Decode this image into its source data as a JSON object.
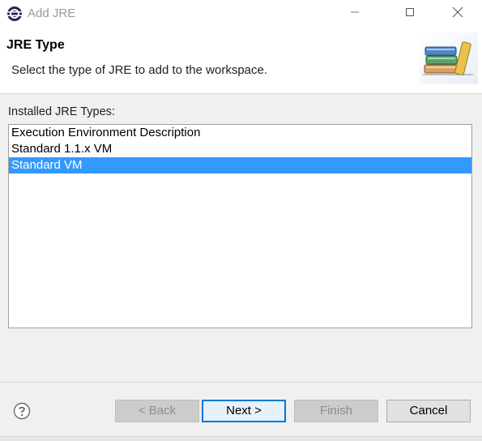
{
  "window": {
    "title": "Add JRE",
    "app_icon": "eclipse-icon",
    "controls": [
      "minimize-icon",
      "maximize-icon",
      "close-icon"
    ]
  },
  "header": {
    "title": "JRE Type",
    "description": "Select the type of JRE to add to the workspace.",
    "banner_icon": "books-icon"
  },
  "main": {
    "list_label": "Installed JRE Types:",
    "jre_types": [
      {
        "label": "Execution Environment Description",
        "selected": false
      },
      {
        "label": "Standard 1.1.x VM",
        "selected": false
      },
      {
        "label": "Standard VM",
        "selected": true
      }
    ]
  },
  "footer": {
    "help_icon": "help-icon",
    "back_label": "< Back",
    "next_label": "Next >",
    "finish_label": "Finish",
    "cancel_label": "Cancel"
  },
  "colors": {
    "selection": "#3399ff",
    "default_button_border": "#0078d7",
    "disabled_text": "#8c8c8c"
  }
}
